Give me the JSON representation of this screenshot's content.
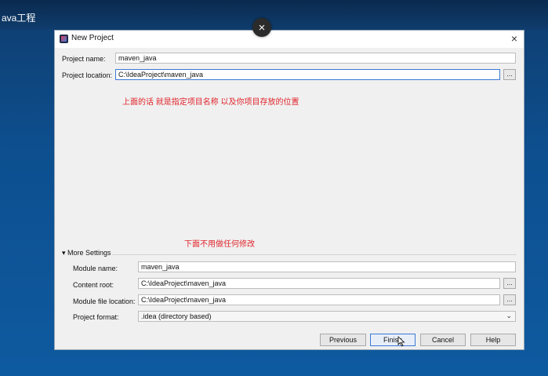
{
  "background": {
    "title_fragment": "ava工程"
  },
  "overlay_close_icon": "×",
  "dialog": {
    "title": "New Project",
    "close_icon": "×",
    "project_name_label": "Project name:",
    "project_name_value": "maven_java",
    "project_location_label": "Project location:",
    "project_location_value": "C:\\IdeaProject\\maven_java",
    "browse_label": "...",
    "note_top": "上面的话  就是指定项目名称  以及你项目存放的位置",
    "note_bottom": "下面不用做任何修改",
    "more_settings_label": "▾ More Settings",
    "module_name_label": "Module name:",
    "module_name_value": "maven_java",
    "content_root_label": "Content root:",
    "content_root_value": "C:\\IdeaProject\\maven_java",
    "module_file_label": "Module file location:",
    "module_file_value": "C:\\IdeaProject\\maven_java",
    "project_format_label": "Project format:",
    "project_format_value": ".idea (directory based)",
    "buttons": {
      "previous": "Previous",
      "finish": "Finish",
      "cancel": "Cancel",
      "help": "Help"
    }
  },
  "colors": {
    "accent": "#3a79d6",
    "note": "#e0242b"
  }
}
